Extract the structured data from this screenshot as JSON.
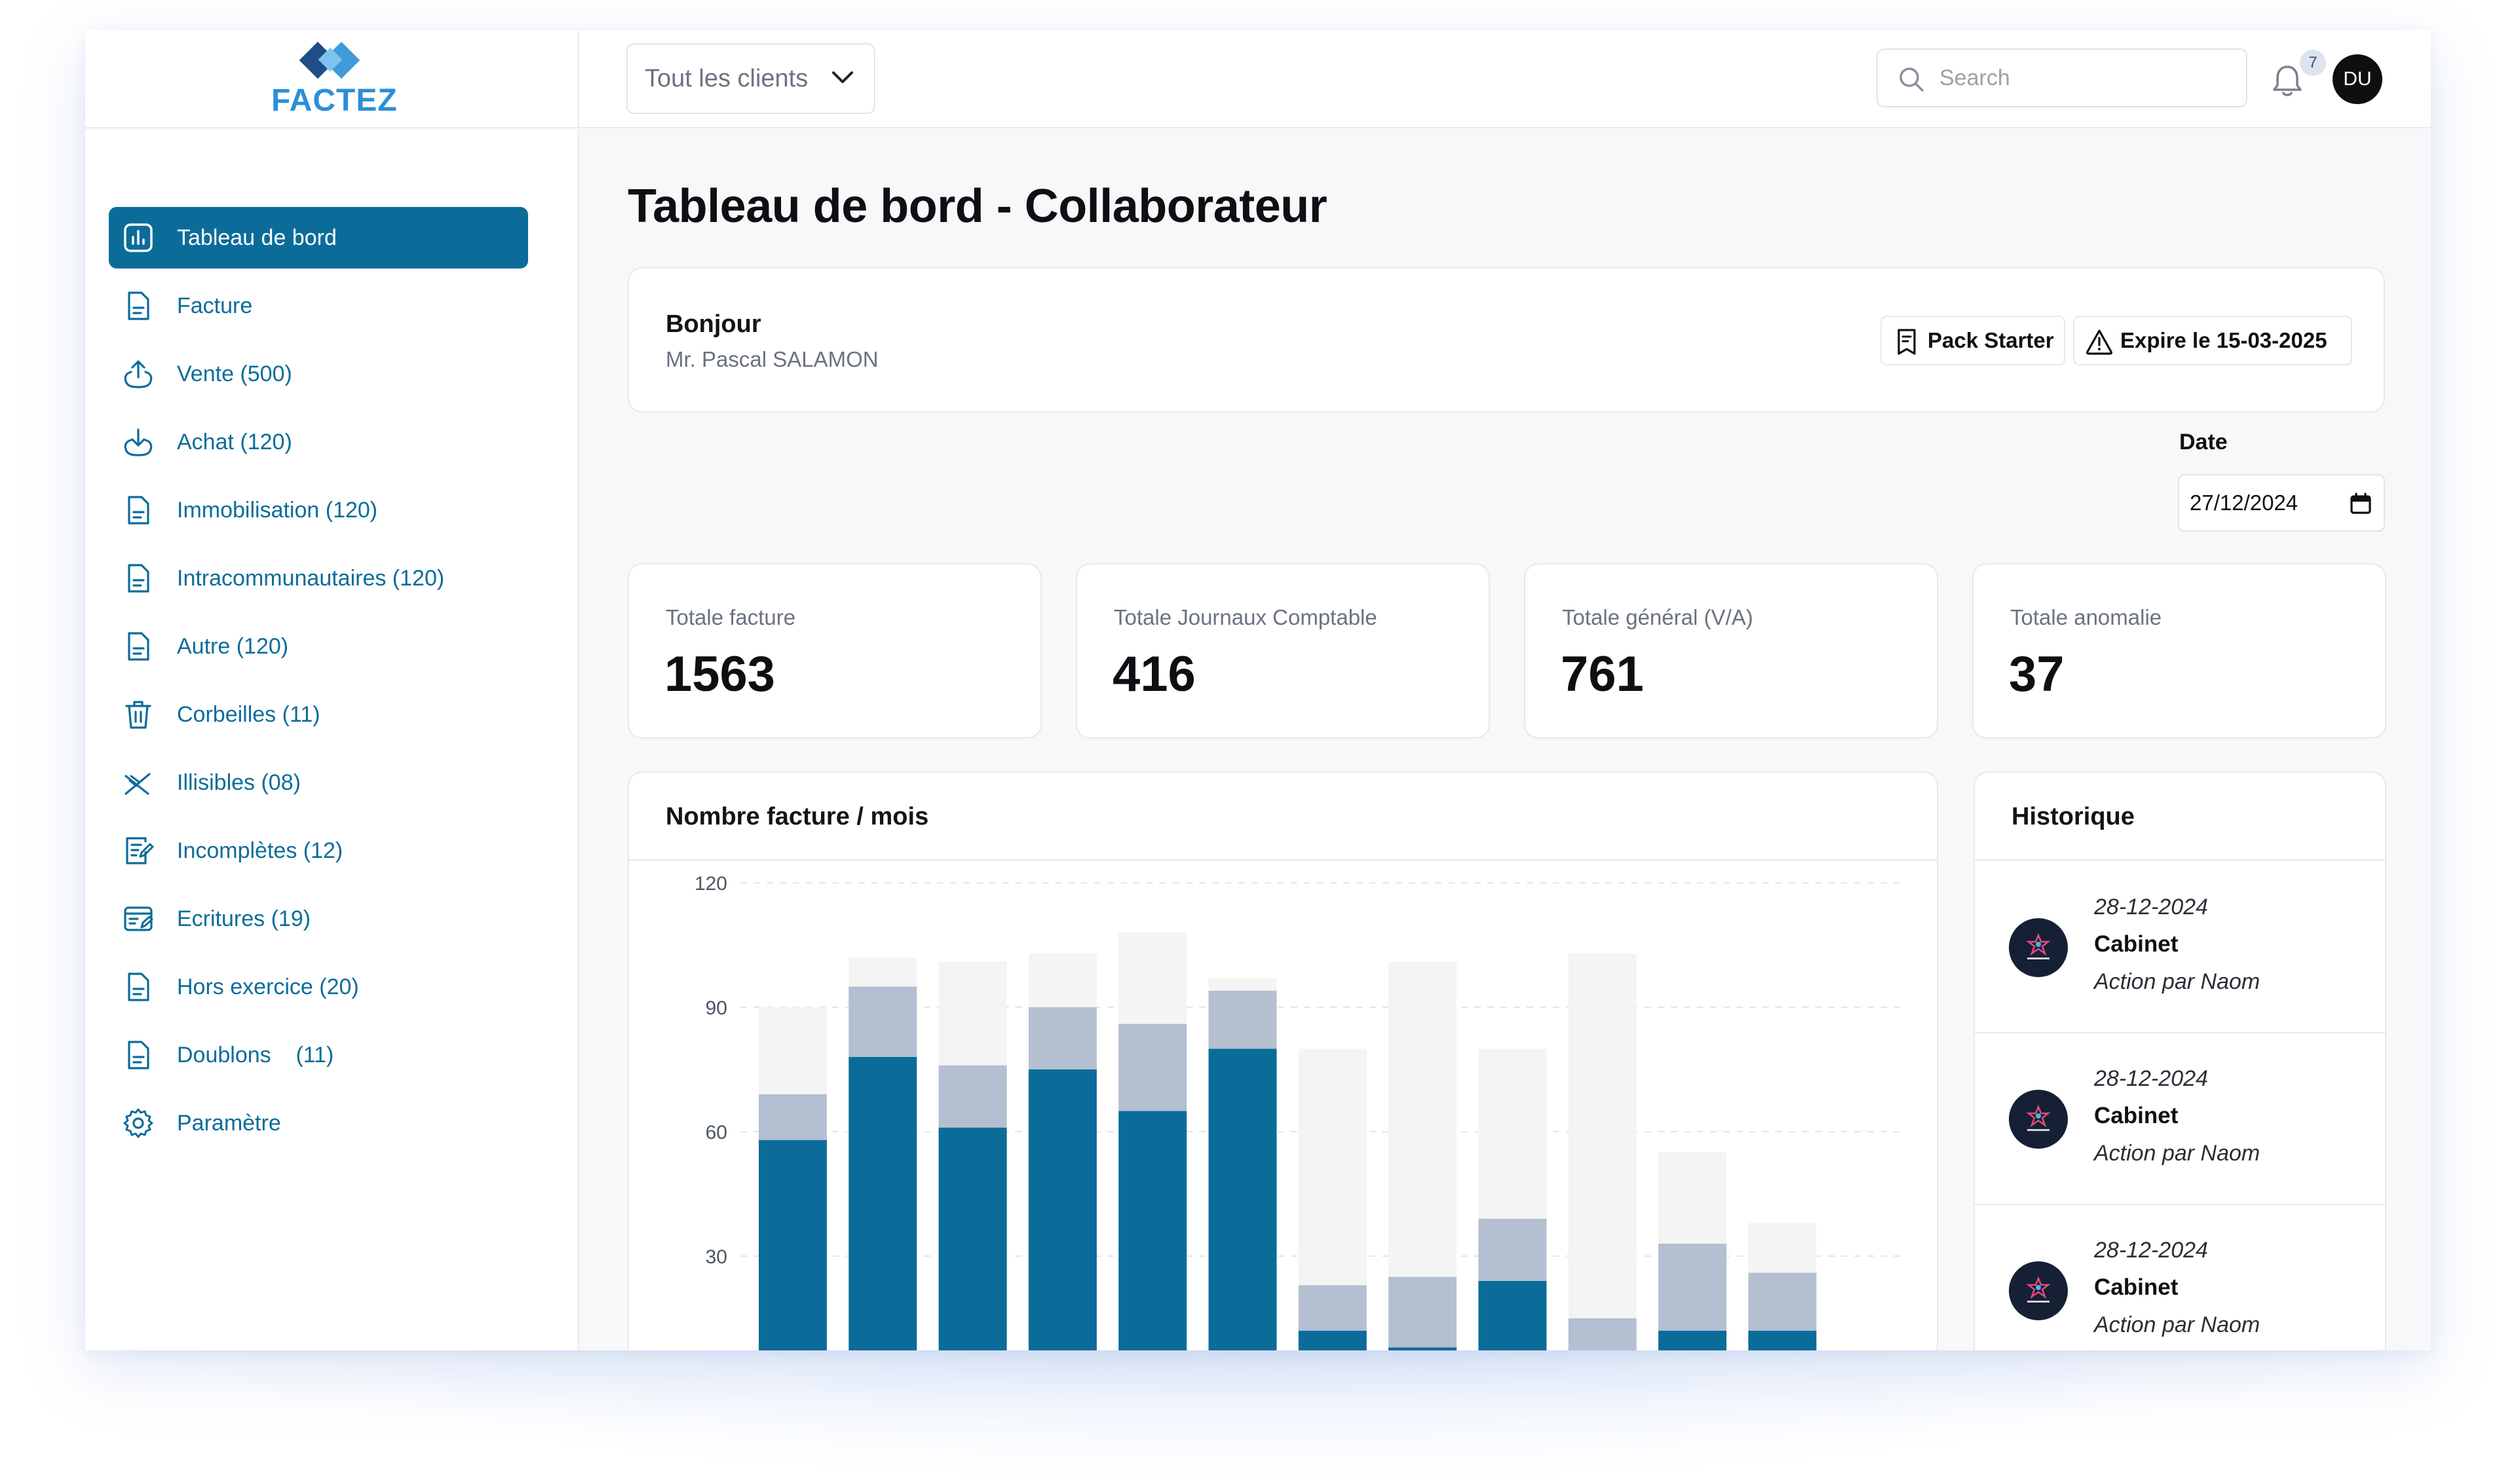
{
  "app": {
    "logo_text": "FACTEZ",
    "brand_colors": {
      "primary": "#0b6c9a",
      "logo": "#2c8fd6",
      "logo_dark": "#1f4d86"
    }
  },
  "topbar": {
    "client_select": "Tout les clients",
    "search_placeholder": "Search",
    "notification_count": "7",
    "avatar_initials": "DU"
  },
  "sidebar": {
    "items": [
      {
        "label": "Tableau de bord",
        "icon": "dashboard-chart-icon",
        "active": true
      },
      {
        "label": "Facture",
        "icon": "document-icon"
      },
      {
        "label": "Vente (500)",
        "icon": "upload-icon"
      },
      {
        "label": "Achat (120)",
        "icon": "download-icon"
      },
      {
        "label": "Immobilisation (120)",
        "icon": "document-icon"
      },
      {
        "label": "Intracommunautaires (120)",
        "icon": "document-icon"
      },
      {
        "label": "Autre (120)",
        "icon": "document-icon"
      },
      {
        "label": "Corbeilles (11)",
        "icon": "trash-icon"
      },
      {
        "label": "Illisibles (08)",
        "icon": "eye-off-icon"
      },
      {
        "label": "Incomplètes (12)",
        "icon": "edit-document-icon"
      },
      {
        "label": "Ecritures (19)",
        "icon": "ledger-icon"
      },
      {
        "label": "Hors exercice (20)",
        "icon": "document-icon"
      },
      {
        "label": "Doublons    (11)",
        "icon": "document-icon"
      },
      {
        "label": "Paramètre",
        "icon": "gear-icon"
      }
    ]
  },
  "main": {
    "title": "Tableau de bord - Collaborateur",
    "greeting": {
      "hello": "Bonjour",
      "name": "Mr. Pascal SALAMON"
    },
    "pack_label": "Pack Starter",
    "expire_label": "Expire le 15-03-2025",
    "date": {
      "label": "Date",
      "value": "27/12/2024"
    },
    "stats": [
      {
        "label": "Totale facture",
        "value": "1563"
      },
      {
        "label": "Totale Journaux Comptable",
        "value": "416"
      },
      {
        "label": "Totale général (V/A)",
        "value": "761"
      },
      {
        "label": "Totale anomalie",
        "value": "37"
      }
    ],
    "chart_title": "Nombre facture / mois",
    "history": {
      "title": "Historique",
      "items": [
        {
          "date": "28-12-2024",
          "name": "Cabinet",
          "action": "Action par Naom"
        },
        {
          "date": "28-12-2024",
          "name": "Cabinet",
          "action": "Action par Naom"
        },
        {
          "date": "28-12-2024",
          "name": "Cabinet",
          "action": "Action par Naom"
        }
      ]
    }
  },
  "chart_data": {
    "type": "bar",
    "stacked": true,
    "title": "Nombre facture / mois",
    "categories": [
      "",
      "",
      "",
      "",
      "",
      "",
      "",
      "",
      "",
      "",
      "",
      ""
    ],
    "series": [
      {
        "color": "#0b6c9a",
        "values": [
          58,
          78,
          61,
          75,
          65,
          80,
          12,
          8,
          24,
          0,
          12,
          12
        ]
      },
      {
        "color": "#b4bfd1",
        "values": [
          11,
          17,
          15,
          15,
          21,
          14,
          11,
          17,
          15,
          15,
          21,
          14
        ]
      },
      {
        "color": "#f4f4f5",
        "values": [
          21,
          7,
          25,
          13,
          22,
          3,
          57,
          76,
          41,
          88,
          22,
          12
        ]
      }
    ],
    "yticks": [
      120,
      90,
      60,
      30
    ],
    "ylim": [
      0,
      120
    ],
    "grid": true
  }
}
